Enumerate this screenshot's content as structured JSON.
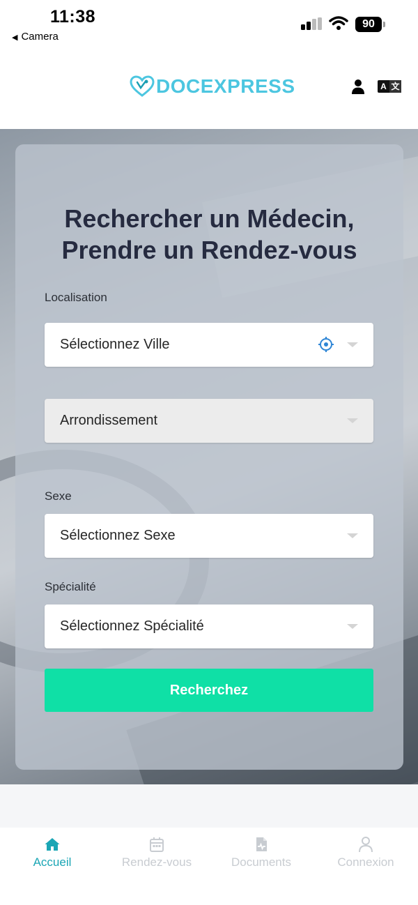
{
  "status_bar": {
    "time": "11:38",
    "back_label": "Camera",
    "battery": "90"
  },
  "header": {
    "logo_text": "DOCEXPRESS",
    "user_icon": "user-icon",
    "language_icon": "translate-icon",
    "language_left": "A",
    "language_right": "文"
  },
  "form": {
    "title_line1": "Rechercher un Médecin,",
    "title_line2": "Prendre un Rendez-vous",
    "location_label": "Localisation",
    "city_placeholder": "Sélectionnez Ville",
    "district_placeholder": "Arrondissement",
    "sex_label": "Sexe",
    "sex_placeholder": "Sélectionnez Sexe",
    "specialty_label": "Spécialité",
    "specialty_placeholder": "Sélectionnez Spécialité",
    "search_button": "Recherchez"
  },
  "bottom_nav": {
    "items": [
      {
        "label": "Accueil",
        "icon": "home-icon",
        "active": true
      },
      {
        "label": "Rendez-vous",
        "icon": "calendar-icon",
        "active": false
      },
      {
        "label": "Documents",
        "icon": "document-icon",
        "active": false
      },
      {
        "label": "Connexion",
        "icon": "user-icon",
        "active": false
      }
    ]
  },
  "colors": {
    "accent": "#0fe0a6",
    "brand": "#4cc6e0",
    "nav_active": "#1ba6b5",
    "title": "#262b40"
  }
}
